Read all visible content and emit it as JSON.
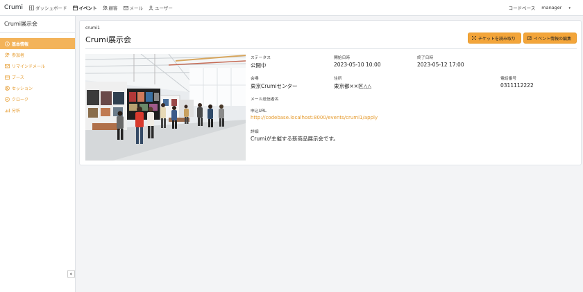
{
  "nav": {
    "brand": "Crumi",
    "items": [
      {
        "label": "ダッシュボード",
        "icon": "dashboard-icon",
        "active": false
      },
      {
        "label": "イベント",
        "icon": "calendar-icon",
        "active": true
      },
      {
        "label": "顧客",
        "icon": "people-icon",
        "active": false
      },
      {
        "label": "メール",
        "icon": "mail-icon",
        "active": false
      },
      {
        "label": "ユーザー",
        "icon": "user-icon",
        "active": false
      }
    ],
    "right_link": "コードベース",
    "user_menu": "manager"
  },
  "sidebar": {
    "title": "Crumi展示会",
    "items": [
      {
        "label": "基本情報",
        "icon": "info-icon",
        "active": true
      },
      {
        "label": "参加者",
        "icon": "participants-icon",
        "active": false
      },
      {
        "label": "リマインドメール",
        "icon": "mail-icon",
        "active": false
      },
      {
        "label": "ブース",
        "icon": "booth-icon",
        "active": false
      },
      {
        "label": "セッション",
        "icon": "session-icon",
        "active": false
      },
      {
        "label": "クローク",
        "icon": "cloak-icon",
        "active": false
      },
      {
        "label": "分析",
        "icon": "chart-icon",
        "active": false
      }
    ],
    "collapse_label": "«"
  },
  "event": {
    "code": "crumi1",
    "title": "Crumi展示会",
    "buttons": {
      "scan": "チケットを読み取り",
      "edit": "イベント情報の編集"
    },
    "fields": {
      "status_label": "ステータス",
      "status_value": "公開中",
      "start_label": "開始日時",
      "start_value": "2023-05-10 10:00",
      "end_label": "終了日時",
      "end_value": "2023-05-12 17:00",
      "venue_label": "会場",
      "venue_value": "東京Crumiセンター",
      "address_label": "住所",
      "address_value": "東京都××区△△",
      "phone_label": "電話番号",
      "phone_value": "0311112222",
      "sender_label": "メール送信者名",
      "sender_value": "",
      "url_label": "申込URL",
      "url_value": "http://codebase.localhost:8000/events/crumi1/apply",
      "detail_label": "詳細",
      "detail_value": "Crumiが主催する新商品展示会です。"
    }
  },
  "colors": {
    "accent": "#f3a53a",
    "accent_text": "#e59a2c",
    "sidebar_active": "#f3b35a"
  }
}
